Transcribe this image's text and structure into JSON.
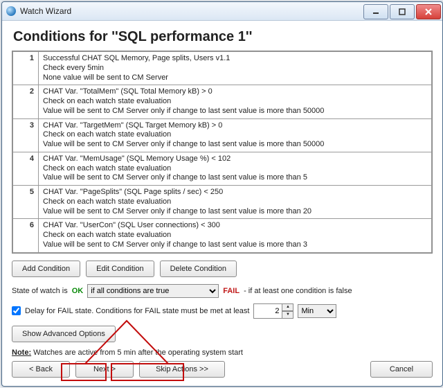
{
  "window": {
    "title": "Watch Wizard"
  },
  "page_title": "Conditions for ''SQL performance 1''",
  "conditions": [
    {
      "n": "1",
      "l1": "Successful CHAT SQL Memory, Page splits, Users v1.1",
      "l2": "Check every 5min",
      "l3": "None value will be sent to CM Server"
    },
    {
      "n": "2",
      "l1": "CHAT Var. \"TotalMem\" (SQL Total Memory kB) > 0",
      "l2": "Check on each watch state evaluation",
      "l3": "Value will be sent to CM Server only if change to last sent value is more than 50000"
    },
    {
      "n": "3",
      "l1": "CHAT Var. \"TargetMem\" (SQL Target Memory kB) > 0",
      "l2": "Check on each watch state evaluation",
      "l3": "Value will be sent to CM Server only if change to last sent value is more than 50000"
    },
    {
      "n": "4",
      "l1": "CHAT Var. \"MemUsage\" (SQL Memory Usage %) < 102",
      "l2": "Check on each watch state evaluation",
      "l3": "Value will be sent to CM Server only if change to last sent value is more than 5"
    },
    {
      "n": "5",
      "l1": "CHAT Var. \"PageSplits\" (SQL Page splits / sec) < 250",
      "l2": "Check on each watch state evaluation",
      "l3": "Value will be sent to CM Server only if change to last sent value is more than 20"
    },
    {
      "n": "6",
      "l1": "CHAT Var. \"UserCon\" (SQL User connections) < 300",
      "l2": "Check on each watch state evaluation",
      "l3": "Value will be sent to CM Server only if change to last sent value is more than 3"
    }
  ],
  "buttons": {
    "add": "Add Condition",
    "edit": "Edit Condition",
    "delete": "Delete Condition",
    "show_adv": "Show Advanced Options",
    "back": "< Back",
    "next": "Next >",
    "skip": "Skip Actions >>",
    "cancel": "Cancel"
  },
  "state": {
    "prefix": "State of watch is",
    "ok": "OK",
    "combo_selected": "if all conditions are true",
    "fail": "FAIL",
    "fail_text": " - if at least one condition is false"
  },
  "delay": {
    "checkbox_label": "Delay for FAIL state. Conditions for FAIL state must be met at least",
    "value": "2",
    "unit_selected": "Min"
  },
  "note": {
    "label": "Note:",
    "text": " Watches are active from 5 min after the operating system start"
  }
}
